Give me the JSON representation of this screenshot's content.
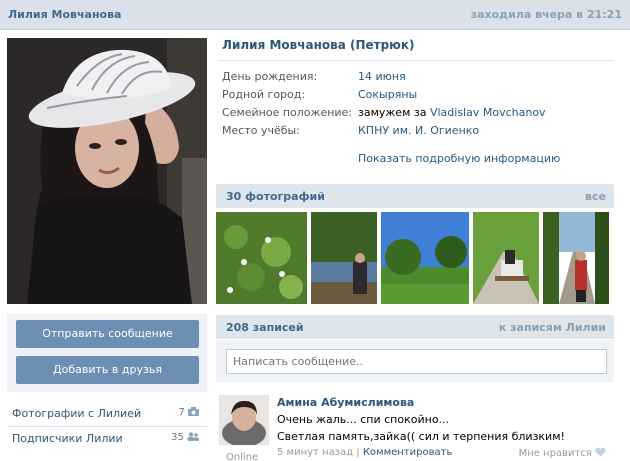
{
  "topbar": {
    "name": "Лилия Мовчанова",
    "last_seen": "заходила вчера в 21:21"
  },
  "profile": {
    "full_name": "Лилия Мовчанова (Петрюк)",
    "info": [
      {
        "key": "День рождения:",
        "value": "14 июня"
      },
      {
        "key": "Родной город:",
        "value": "Сокыряны"
      },
      {
        "key": "Семейное положение:",
        "value_prefix": "замужем за",
        "value": "Vladislav Movchanov"
      },
      {
        "key": "Место учёбы:",
        "value": "КПНУ им. И. Огиенко"
      }
    ],
    "more_link": "Показать подробную информацию"
  },
  "actions": {
    "send_message": "Отправить сообщение",
    "add_friend": "Добавить в друзья"
  },
  "links": [
    {
      "label": "Фотографии с Лилией",
      "count": "7"
    },
    {
      "label": "Подписчики Лилии",
      "count": "35"
    }
  ],
  "photos": {
    "title": "30 фотографий",
    "all_link": "все"
  },
  "wall": {
    "title": "208 записей",
    "to_posts_link": "к записям Лилии",
    "composer_placeholder": "Написать сообщение..",
    "post": {
      "author": "Амина Абумислимова",
      "line1": "Очень жаль... спи спокойно...",
      "line2": "Светлая память,зайка(( сил и терпения близким!",
      "time": "5 минут назад",
      "separator": "|",
      "comment_link": "Комментировать",
      "like": "Мне нравится",
      "online": "Online"
    }
  },
  "colors": {
    "accent": "#2b587a",
    "header_bg": "#dae1e8",
    "button_bg": "#6d8fb3"
  }
}
